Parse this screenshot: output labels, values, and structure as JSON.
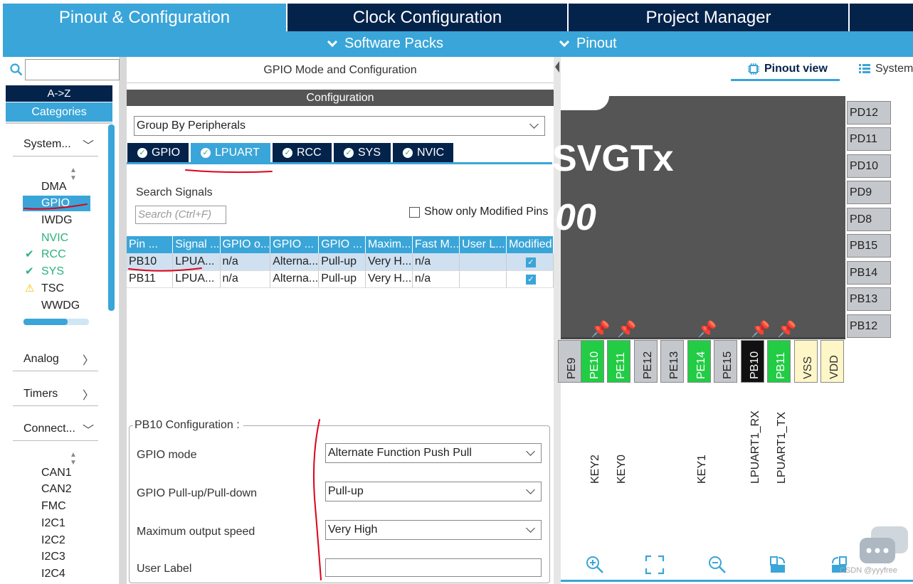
{
  "top_tabs": [
    "Pinout & Configuration",
    "Clock Configuration",
    "Project Manager"
  ],
  "sub_menus": [
    "Software Packs",
    "Pinout"
  ],
  "left": {
    "sort_az": "A->Z",
    "sort_categories": "Categories",
    "groups": {
      "system": "System...",
      "analog": "Analog",
      "timers": "Timers",
      "connectivity": "Connect..."
    },
    "system_items": [
      {
        "label": "DMA",
        "status": "none"
      },
      {
        "label": "GPIO",
        "status": "selected"
      },
      {
        "label": "IWDG",
        "status": "none"
      },
      {
        "label": "NVIC",
        "status": "green"
      },
      {
        "label": "RCC",
        "status": "ok"
      },
      {
        "label": "SYS",
        "status": "ok"
      },
      {
        "label": "TSC",
        "status": "warning"
      },
      {
        "label": "WWDG",
        "status": "none"
      }
    ],
    "connectivity_items": [
      "CAN1",
      "CAN2",
      "FMC",
      "I2C1",
      "I2C2",
      "I2C3",
      "I2C4"
    ]
  },
  "middle": {
    "title": "GPIO Mode and Configuration",
    "config_header": "Configuration",
    "group_by": "Group By Peripherals",
    "tabs": [
      "GPIO",
      "LPUART",
      "RCC",
      "SYS",
      "NVIC"
    ],
    "active_tab": "LPUART",
    "search_label": "Search Signals",
    "search_placeholder": "Search (Ctrl+F)",
    "show_modified": "Show only Modified Pins",
    "columns": [
      "Pin ...",
      "Signal ...",
      "GPIO o...",
      "GPIO ...",
      "GPIO ...",
      "Maxim...",
      "Fast M...",
      "User L...",
      "Modified"
    ],
    "rows": [
      {
        "pin": "PB10",
        "signal": "LPUA...",
        "gpio_out": "n/a",
        "gpio_mode": "Alterna...",
        "pull": "Pull-up",
        "speed": "Very H...",
        "fast": "n/a",
        "user": "",
        "modified": true
      },
      {
        "pin": "PB11",
        "signal": "LPUA...",
        "gpio_out": "n/a",
        "gpio_mode": "Alterna...",
        "pull": "Pull-up",
        "speed": "Very H...",
        "fast": "n/a",
        "user": "",
        "modified": true
      }
    ],
    "pin_config": {
      "title": "PB10 Configuration :",
      "gpio_mode_label": "GPIO mode",
      "gpio_mode_value": "Alternate Function Push Pull",
      "pull_label": "GPIO Pull-up/Pull-down",
      "pull_value": "Pull-up",
      "speed_label": "Maximum output speed",
      "speed_value": "Very High",
      "user_label_label": "User Label",
      "user_label_value": ""
    }
  },
  "right": {
    "view_tabs": [
      "Pinout view",
      "System"
    ],
    "chip_name": "SVGTx",
    "chip_number": "00",
    "right_pins": [
      "PD12",
      "PD11",
      "PD10",
      "PD9",
      "PD8",
      "PB15",
      "PB14",
      "PB13",
      "PB12"
    ],
    "bottom_pins": [
      {
        "name": "PE9",
        "color": "grey"
      },
      {
        "name": "PE10",
        "color": "green"
      },
      {
        "name": "PE11",
        "color": "green"
      },
      {
        "name": "PE12",
        "color": "grey"
      },
      {
        "name": "PE13",
        "color": "grey"
      },
      {
        "name": "PE14",
        "color": "green"
      },
      {
        "name": "PE15",
        "color": "grey"
      },
      {
        "name": "PB10",
        "color": "black"
      },
      {
        "name": "PB11",
        "color": "green"
      },
      {
        "name": "VSS",
        "color": "yellow"
      },
      {
        "name": "VDD",
        "color": "yellow"
      }
    ],
    "pin_labels": [
      "KEY2",
      "KEY0",
      "KEY1",
      "LPUART1_RX",
      "LPUART1_TX"
    ],
    "watermark": "CSDN @yyyfree"
  },
  "colors": {
    "accent": "#3aa5d8",
    "dark": "#03234b",
    "pin_green": "#22cc44",
    "annotation": "#e0001a"
  }
}
